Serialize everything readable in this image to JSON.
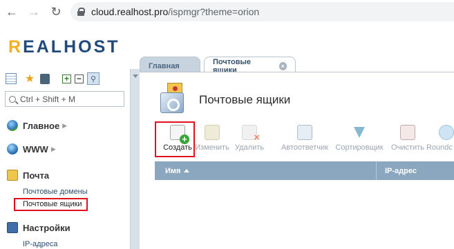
{
  "browser": {
    "url_host": "cloud.realhost.pro",
    "url_path": "/ispmgr?theme=orion"
  },
  "logo": {
    "text_rest": "EALHOST",
    "text_first": "R"
  },
  "sidebar": {
    "search_placeholder": "Ctrl + Shift + M",
    "groups": [
      {
        "label": "Главное",
        "icon": "home-globe-icon"
      },
      {
        "label": "WWW",
        "icon": "www-globe-icon"
      },
      {
        "label": "Почта",
        "icon": "mail-icon"
      },
      {
        "label": "Настройки",
        "icon": "settings-icon"
      }
    ],
    "mail_items": [
      "Почтовые домены",
      "Почтовые ящики"
    ],
    "settings_items": [
      "IP-адреса"
    ]
  },
  "tabs": [
    {
      "label": "Главная",
      "active": false
    },
    {
      "label": "Почтовые ящики",
      "active": true
    }
  ],
  "page": {
    "title": "Почтовые ящики"
  },
  "toolbar": [
    {
      "label": "Создать",
      "enabled": true,
      "icon": "create-icon"
    },
    {
      "label": "Изменить",
      "enabled": false,
      "icon": "edit-icon"
    },
    {
      "label": "Удалить",
      "enabled": false,
      "icon": "delete-icon"
    },
    {
      "label": "Автоответчик",
      "enabled": false,
      "icon": "autoresponder-icon"
    },
    {
      "label": "Сортировщик",
      "enabled": false,
      "icon": "sorter-icon"
    },
    {
      "label": "Очистить",
      "enabled": false,
      "icon": "clear-icon"
    },
    {
      "label": "Roundc",
      "enabled": false,
      "icon": "roundcube-icon"
    }
  ],
  "grid": {
    "columns": [
      "Имя",
      "IP-адрес"
    ],
    "sort_column": "Имя"
  },
  "colors": {
    "accent_border": "#e0101d",
    "grid_header": "#8ba7bf",
    "logo_primary": "#1f4a7a",
    "logo_secondary": "#f2b01e"
  }
}
